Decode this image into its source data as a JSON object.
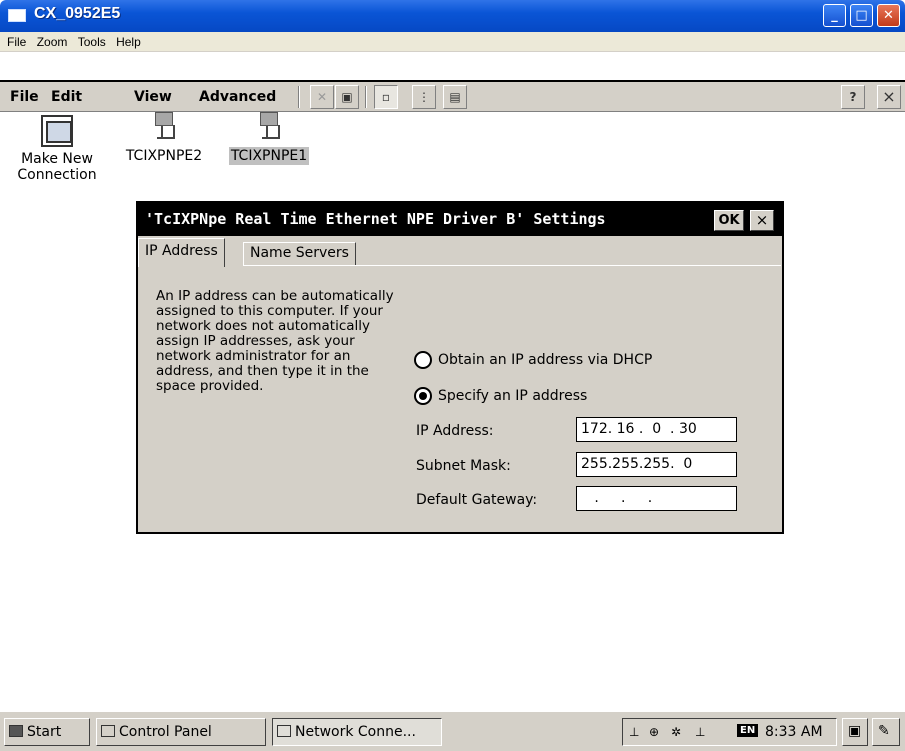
{
  "window": {
    "title": "CX_0952E5",
    "buttons": [
      "minimize",
      "maximize",
      "close"
    ]
  },
  "host_menu": {
    "items": [
      "File",
      "Zoom",
      "Tools",
      "Help"
    ]
  },
  "ce_menu": {
    "items": [
      "File",
      "Edit",
      "View",
      "Advanced"
    ],
    "help": "?",
    "close": "×"
  },
  "desktop_icons": [
    {
      "label_line1": "Make New",
      "label_line2": "Connection",
      "icon": "make-connection-icon"
    },
    {
      "label": "TCIXPNPE2",
      "icon": "network-adapter-icon"
    },
    {
      "label": "TCIXPNPE1",
      "icon": "network-adapter-icon",
      "selected": true
    }
  ],
  "dialog": {
    "title": "'TcIXPNpe Real Time Ethernet NPE Driver B' Settings",
    "ok_label": "OK",
    "close_label": "×",
    "tabs": [
      "IP Address",
      "Name Servers"
    ],
    "active_tab": "IP Address",
    "info_text": "An IP address can be automatically assigned to this computer.  If your network does not automatically assign IP addresses, ask your network administrator for an address, and then type it in the space provided.",
    "radio_dhcp": {
      "label": "Obtain an IP address via DHCP",
      "checked": false
    },
    "radio_specify": {
      "label": "Specify an IP address",
      "checked": true
    },
    "ip_address": {
      "label": "IP Address:",
      "value": "172. 16 .  0  . 30"
    },
    "subnet_mask": {
      "label": "Subnet Mask:",
      "value": "255.255.255.  0"
    },
    "default_gateway": {
      "label": "Default Gateway:",
      "value": "   .     .     .   "
    }
  },
  "taskbar": {
    "start": "Start",
    "tasks": [
      "Control Panel",
      "Network Conne..."
    ],
    "active_task": "Network Conne...",
    "input_lang": "EN",
    "clock": "8:33 AM"
  },
  "colors": {
    "xp_title": "#0a55d6",
    "ce_face": "#d4d0c8",
    "dialog_title": "#000000"
  }
}
